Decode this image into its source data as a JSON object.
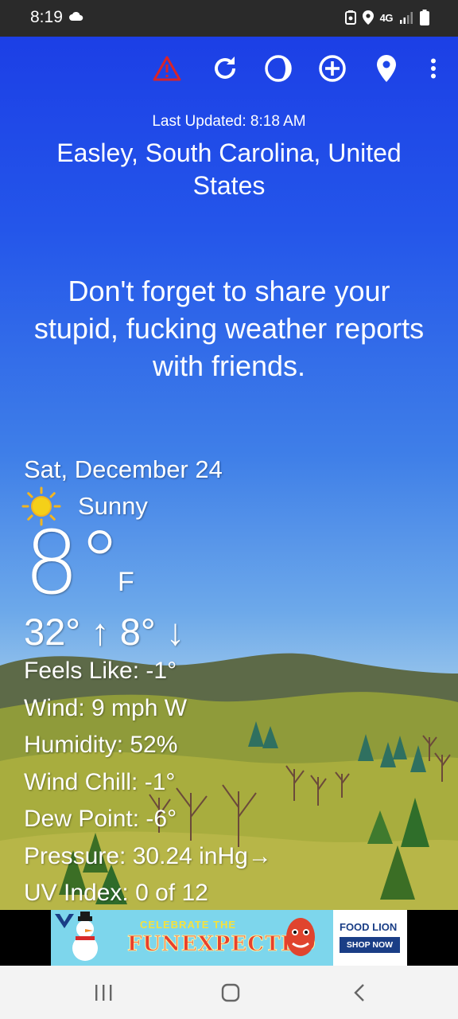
{
  "status_bar": {
    "time": "8:19",
    "network": "4G",
    "icons": [
      "cloud-icon",
      "battery-saver-icon",
      "location-icon",
      "signal-icon",
      "battery-icon"
    ]
  },
  "toolbar": {
    "icons": [
      "alert-warning-icon",
      "refresh-icon",
      "theme-icon",
      "add-location-icon",
      "location-pin-icon",
      "more-vert-icon"
    ],
    "alert_color": "#d8232a"
  },
  "header": {
    "last_updated": "Last Updated: 8:18 AM",
    "location": "Easley, South Carolina, United States"
  },
  "message": "Don't forget to share your stupid, fucking weather reports with friends.",
  "weather": {
    "date": "Sat, December 24",
    "condition": "Sunny",
    "condition_icon": "sun-icon",
    "temperature": "8°",
    "unit": "F",
    "high_low": "32° ↑ 8° ↓",
    "details": [
      "Feels Like:  -1°",
      "Wind:  9 mph W",
      "Humidity:  52%",
      "Wind Chill:  -1°",
      "Dew Point:  -6°",
      "Pressure:  30.24 inHg→",
      "UV Index:  0 of 12"
    ]
  },
  "ad": {
    "line1": "CELEBRATE THE",
    "line2": "FUNEXPECTED",
    "brand": "FOOD LION",
    "cta": "SHOP NOW"
  },
  "nav": {
    "icons": [
      "recent-apps-icon",
      "home-icon",
      "back-icon"
    ]
  }
}
